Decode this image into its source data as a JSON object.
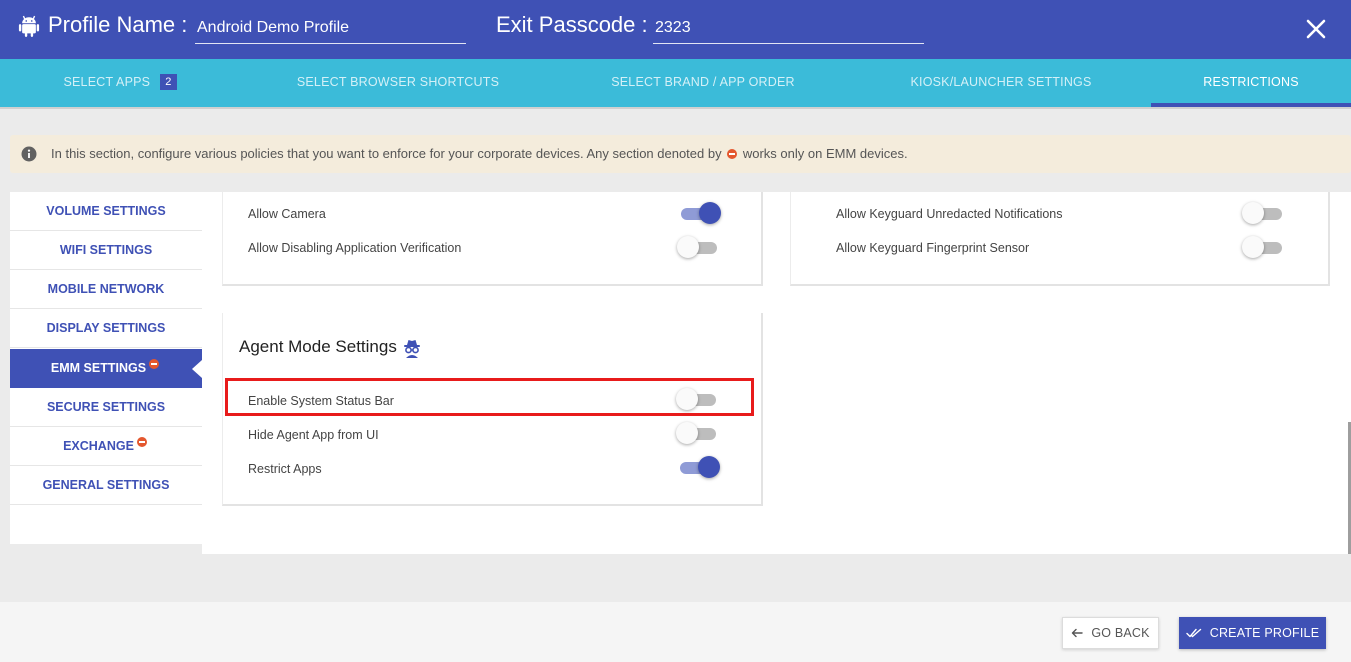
{
  "header": {
    "profile_label": "Profile Name :",
    "profile_value": "Android Demo Profile",
    "passcode_label": "Exit Passcode :",
    "passcode_value": "2323",
    "icon": "android-icon",
    "close_icon": "close-icon"
  },
  "tabs": [
    {
      "label": "SELECT APPS",
      "badge": "2"
    },
    {
      "label": "SELECT BROWSER SHORTCUTS"
    },
    {
      "label": "SELECT BRAND / APP ORDER"
    },
    {
      "label": "KIOSK/LAUNCHER SETTINGS"
    },
    {
      "label": "RESTRICTIONS",
      "active": true
    }
  ],
  "info": {
    "text_before": "In this section, configure various policies that you want to enforce for your corporate devices. Any section denoted by",
    "text_after": "works only on EMM devices."
  },
  "sidebar": {
    "items": [
      {
        "label": "VOLUME SETTINGS"
      },
      {
        "label": "WIFI SETTINGS"
      },
      {
        "label": "MOBILE NETWORK"
      },
      {
        "label": "DISPLAY SETTINGS"
      },
      {
        "label": "EMM SETTINGS",
        "emm": true,
        "active": true
      },
      {
        "label": "SECURE SETTINGS"
      },
      {
        "label": "EXCHANGE",
        "emm": true
      },
      {
        "label": "GENERAL SETTINGS"
      }
    ]
  },
  "left_card": {
    "rows": [
      {
        "label": "Allow Camera",
        "on": true
      },
      {
        "label": "Allow Disabling Application Verification",
        "on": false
      }
    ]
  },
  "right_card": {
    "rows": [
      {
        "label": "Allow Keyguard Unredacted Notifications",
        "on": false
      },
      {
        "label": "Allow Keyguard Fingerprint Sensor",
        "on": false
      }
    ]
  },
  "agent_card": {
    "title": "Agent Mode Settings",
    "icon": "agent-spy-icon",
    "rows": [
      {
        "label": "Enable System Status Bar",
        "on": false
      },
      {
        "label": "Hide Agent App from UI",
        "on": false
      },
      {
        "label": "Restrict Apps",
        "on": true
      }
    ]
  },
  "footer": {
    "back_label": "GO BACK",
    "create_label": "CREATE PROFILE"
  },
  "colors": {
    "primary": "#3f51b5",
    "tabs_bg": "#3bbbd9",
    "info_bg": "#f4ecdc",
    "emm_mark": "#e4572e",
    "highlight": "#e81b1b"
  }
}
